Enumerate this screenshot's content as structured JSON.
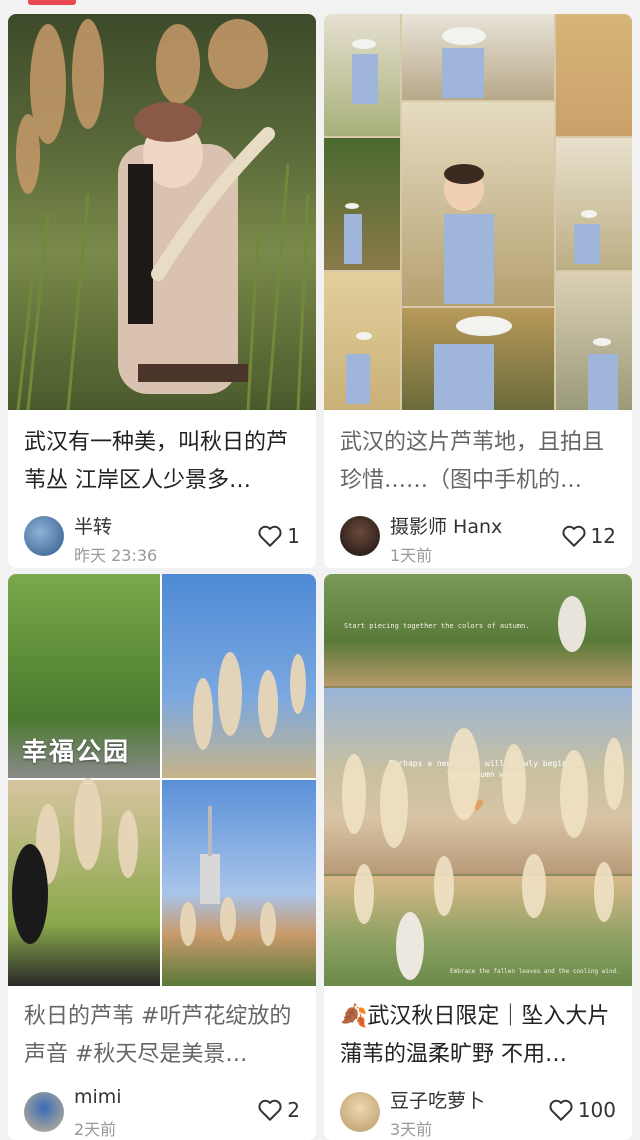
{
  "feed": {
    "cards": [
      {
        "title": "武汉有一种美，叫秋日的芦苇丛 江岸区人少景多…",
        "author": "半转",
        "time": "昨天 23:36",
        "likes": "1"
      },
      {
        "title": "武汉的这片芦苇地，且拍且珍惜……（图中手机的…",
        "author": "摄影师 Hanx",
        "time": "1天前",
        "likes": "12"
      },
      {
        "title": "秋日的芦苇 #听芦花绽放的声音 #秋天尽是美景…",
        "author": "mimi",
        "time": "2天前",
        "likes": "2",
        "image_sign": "幸福公园"
      },
      {
        "title_emoji": "🍂",
        "title": "武汉秋日限定｜坠入大片蒲苇的温柔旷野 不用…",
        "author": "豆子吃萝卜",
        "time": "3天前",
        "likes": "100",
        "image_caption_1": "Start piecing together the colors of autumn.",
        "image_caption_2": "Perhaps a new story will slowly begin in the autumn wind.",
        "image_caption_3": "Embrace the fallen leaves and the cooling wind."
      }
    ]
  },
  "colors": {
    "accent": "#e8474f",
    "background": "#f2f2f2"
  }
}
